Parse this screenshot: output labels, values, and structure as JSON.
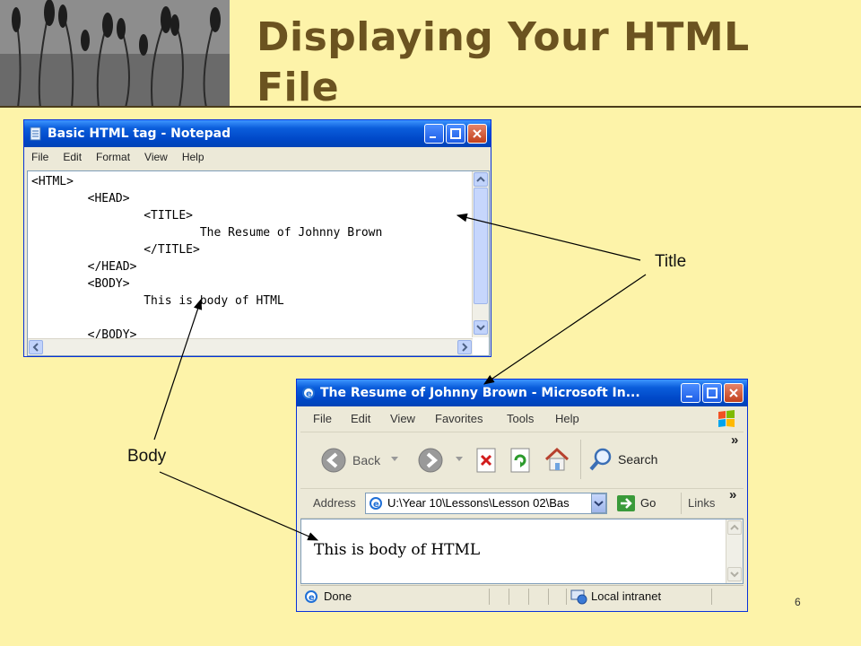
{
  "slide": {
    "title": "Displaying Your HTML File",
    "page_number": "6",
    "callouts": {
      "title": "Title",
      "body": "Body"
    }
  },
  "notepad": {
    "window_title": "Basic HTML tag - Notepad",
    "menu": [
      "File",
      "Edit",
      "Format",
      "View",
      "Help"
    ],
    "code_lines": [
      "<HTML>",
      "        <HEAD>",
      "                <TITLE>",
      "                        The Resume of Johnny Brown",
      "                </TITLE>",
      "        </HEAD>",
      "",
      "        <BODY>",
      "                This is body of HTML",
      "",
      "        </BODY>"
    ]
  },
  "browser": {
    "window_title": "The Resume of Johnny Brown - Microsoft In...",
    "menu": [
      "File",
      "Edit",
      "View",
      "Favorites",
      "Tools",
      "Help"
    ],
    "toolbar": {
      "back_label": "Back",
      "search_label": "Search"
    },
    "address_label": "Address",
    "address_value": "U:\\Year 10\\Lessons\\Lesson 02\\Bas",
    "go_label": "Go",
    "links_label": "Links",
    "page_text": "This is body of HTML",
    "status_text": "Done",
    "zone_text": "Local intranet"
  },
  "colors": {
    "background": "#fdf3a9",
    "title": "#6b5320",
    "xp_blue": "#0a5ddb"
  }
}
